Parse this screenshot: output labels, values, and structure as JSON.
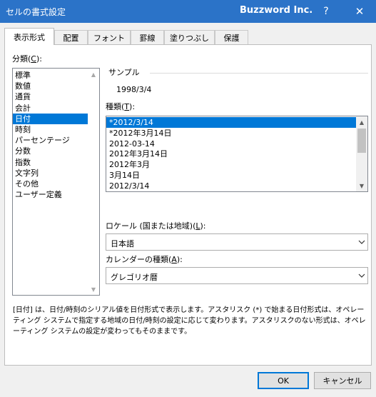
{
  "titlebar": {
    "title": "セルの書式設定",
    "company": "Buzzword Inc.",
    "help_label": "?",
    "close_label": "✕"
  },
  "tabs": [
    {
      "label": "表示形式",
      "active": true
    },
    {
      "label": "配置",
      "active": false
    },
    {
      "label": "フォント",
      "active": false
    },
    {
      "label": "罫線",
      "active": false
    },
    {
      "label": "塗りつぶし",
      "active": false
    },
    {
      "label": "保護",
      "active": false
    }
  ],
  "category": {
    "label_prefix": "分類(",
    "label_key": "C",
    "label_suffix": "):",
    "items": [
      "標準",
      "数値",
      "通貨",
      "会計",
      "日付",
      "時刻",
      "パーセンテージ",
      "分数",
      "指数",
      "文字列",
      "その他",
      "ユーザー定義"
    ],
    "selected": "日付"
  },
  "sample": {
    "label": "サンプル",
    "value": "1998/3/4"
  },
  "type": {
    "label_prefix": "種類(",
    "label_key": "T",
    "label_suffix": "):",
    "items": [
      "*2012/3/14",
      "*2012年3月14日",
      "2012-03-14",
      "2012年3月14日",
      "2012年3月",
      "3月14日",
      "2012/3/14"
    ],
    "selected": "*2012/3/14"
  },
  "locale": {
    "label_prefix": "ロケール (国または地域)(",
    "label_key": "L",
    "label_suffix": "):",
    "value": "日本語"
  },
  "calendar": {
    "label_prefix": "カレンダーの種類(",
    "label_key": "A",
    "label_suffix": "):",
    "value": "グレゴリオ暦"
  },
  "description": "[日付] は、日付/時刻のシリアル値を日付形式で表示します。アスタリスク (*) で始まる日付形式は、オペレーティング システムで指定する地域の日付/時刻の設定に応じて変わります。アスタリスクのない形式は、オペレーティング システムの設定が変わってもそのままです。",
  "buttons": {
    "ok": "OK",
    "cancel": "キャンセル"
  },
  "colors": {
    "titlebar": "#2b73c8",
    "selection": "#0078d7"
  }
}
